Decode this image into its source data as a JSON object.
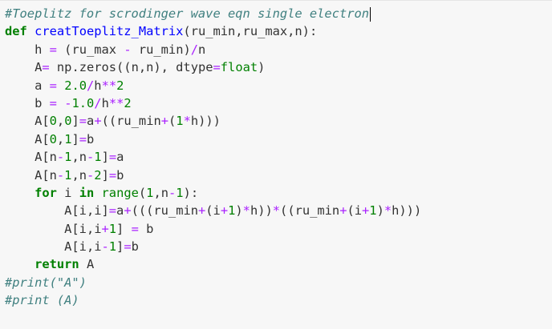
{
  "cell": {
    "lines": [
      {
        "i": "",
        "t": [
          {
            "c": "comment",
            "v": "#Toeplitz for scrodinger wave eqn single electron"
          }
        ]
      },
      {
        "i": "",
        "t": [
          {
            "c": "kw",
            "v": "def"
          },
          {
            "c": "p",
            "v": " "
          },
          {
            "c": "fn",
            "v": "creatToeplitz_Matrix"
          },
          {
            "c": "p",
            "v": "(ru_min,ru_max,n):"
          }
        ]
      },
      {
        "i": "    ",
        "t": [
          {
            "c": "p",
            "v": "h "
          },
          {
            "c": "op",
            "v": "="
          },
          {
            "c": "p",
            "v": " (ru_max "
          },
          {
            "c": "op",
            "v": "-"
          },
          {
            "c": "p",
            "v": " ru_min)"
          },
          {
            "c": "op",
            "v": "/"
          },
          {
            "c": "p",
            "v": "n"
          }
        ]
      },
      {
        "i": "    ",
        "t": [
          {
            "c": "p",
            "v": "A"
          },
          {
            "c": "op",
            "v": "="
          },
          {
            "c": "p",
            "v": " np.zeros((n,n), dtype"
          },
          {
            "c": "op",
            "v": "="
          },
          {
            "c": "builtin-type",
            "v": "float"
          },
          {
            "c": "p",
            "v": ")"
          }
        ]
      },
      {
        "i": "    ",
        "t": [
          {
            "c": "p",
            "v": "a "
          },
          {
            "c": "op",
            "v": "="
          },
          {
            "c": "p",
            "v": " "
          },
          {
            "c": "num",
            "v": "2.0"
          },
          {
            "c": "op",
            "v": "/"
          },
          {
            "c": "p",
            "v": "h"
          },
          {
            "c": "op",
            "v": "**"
          },
          {
            "c": "num",
            "v": "2"
          }
        ]
      },
      {
        "i": "    ",
        "t": [
          {
            "c": "p",
            "v": "b "
          },
          {
            "c": "op",
            "v": "="
          },
          {
            "c": "p",
            "v": " "
          },
          {
            "c": "op",
            "v": "-"
          },
          {
            "c": "num",
            "v": "1.0"
          },
          {
            "c": "op",
            "v": "/"
          },
          {
            "c": "p",
            "v": "h"
          },
          {
            "c": "op",
            "v": "**"
          },
          {
            "c": "num",
            "v": "2"
          }
        ]
      },
      {
        "i": "    ",
        "t": [
          {
            "c": "p",
            "v": "A["
          },
          {
            "c": "num",
            "v": "0"
          },
          {
            "c": "p",
            "v": ","
          },
          {
            "c": "num",
            "v": "0"
          },
          {
            "c": "p",
            "v": "]"
          },
          {
            "c": "op",
            "v": "="
          },
          {
            "c": "p",
            "v": "a"
          },
          {
            "c": "op",
            "v": "+"
          },
          {
            "c": "p",
            "v": "((ru_min"
          },
          {
            "c": "op",
            "v": "+"
          },
          {
            "c": "p",
            "v": "("
          },
          {
            "c": "num",
            "v": "1"
          },
          {
            "c": "op",
            "v": "*"
          },
          {
            "c": "p",
            "v": "h)))"
          }
        ]
      },
      {
        "i": "    ",
        "t": [
          {
            "c": "p",
            "v": "A["
          },
          {
            "c": "num",
            "v": "0"
          },
          {
            "c": "p",
            "v": ","
          },
          {
            "c": "num",
            "v": "1"
          },
          {
            "c": "p",
            "v": "]"
          },
          {
            "c": "op",
            "v": "="
          },
          {
            "c": "p",
            "v": "b"
          }
        ]
      },
      {
        "i": "    ",
        "t": [
          {
            "c": "p",
            "v": "A[n"
          },
          {
            "c": "op",
            "v": "-"
          },
          {
            "c": "num",
            "v": "1"
          },
          {
            "c": "p",
            "v": ",n"
          },
          {
            "c": "op",
            "v": "-"
          },
          {
            "c": "num",
            "v": "1"
          },
          {
            "c": "p",
            "v": "]"
          },
          {
            "c": "op",
            "v": "="
          },
          {
            "c": "p",
            "v": "a"
          }
        ]
      },
      {
        "i": "    ",
        "t": [
          {
            "c": "p",
            "v": "A[n"
          },
          {
            "c": "op",
            "v": "-"
          },
          {
            "c": "num",
            "v": "1"
          },
          {
            "c": "p",
            "v": ",n"
          },
          {
            "c": "op",
            "v": "-"
          },
          {
            "c": "num",
            "v": "2"
          },
          {
            "c": "p",
            "v": "]"
          },
          {
            "c": "op",
            "v": "="
          },
          {
            "c": "p",
            "v": "b"
          }
        ]
      },
      {
        "i": "    ",
        "t": [
          {
            "c": "kw",
            "v": "for"
          },
          {
            "c": "p",
            "v": " i "
          },
          {
            "c": "kw",
            "v": "in"
          },
          {
            "c": "p",
            "v": " "
          },
          {
            "c": "builtin-type",
            "v": "range"
          },
          {
            "c": "p",
            "v": "("
          },
          {
            "c": "num",
            "v": "1"
          },
          {
            "c": "p",
            "v": ",n"
          },
          {
            "c": "op",
            "v": "-"
          },
          {
            "c": "num",
            "v": "1"
          },
          {
            "c": "p",
            "v": "):"
          }
        ]
      },
      {
        "i": "        ",
        "t": [
          {
            "c": "p",
            "v": "A[i,i]"
          },
          {
            "c": "op",
            "v": "="
          },
          {
            "c": "p",
            "v": "a"
          },
          {
            "c": "op",
            "v": "+"
          },
          {
            "c": "p",
            "v": "(((ru_min"
          },
          {
            "c": "op",
            "v": "+"
          },
          {
            "c": "p",
            "v": "(i"
          },
          {
            "c": "op",
            "v": "+"
          },
          {
            "c": "num",
            "v": "1"
          },
          {
            "c": "p",
            "v": ")"
          },
          {
            "c": "op",
            "v": "*"
          },
          {
            "c": "p",
            "v": "h))"
          },
          {
            "c": "op",
            "v": "*"
          },
          {
            "c": "p",
            "v": "((ru_min"
          },
          {
            "c": "op",
            "v": "+"
          },
          {
            "c": "p",
            "v": "(i"
          },
          {
            "c": "op",
            "v": "+"
          },
          {
            "c": "num",
            "v": "1"
          },
          {
            "c": "p",
            "v": ")"
          },
          {
            "c": "op",
            "v": "*"
          },
          {
            "c": "p",
            "v": "h)))"
          }
        ]
      },
      {
        "i": "        ",
        "t": [
          {
            "c": "p",
            "v": "A[i,i"
          },
          {
            "c": "op",
            "v": "+"
          },
          {
            "c": "num",
            "v": "1"
          },
          {
            "c": "p",
            "v": "] "
          },
          {
            "c": "op",
            "v": "="
          },
          {
            "c": "p",
            "v": " b"
          }
        ]
      },
      {
        "i": "        ",
        "t": [
          {
            "c": "p",
            "v": "A[i,i"
          },
          {
            "c": "op",
            "v": "-"
          },
          {
            "c": "num",
            "v": "1"
          },
          {
            "c": "p",
            "v": "]"
          },
          {
            "c": "op",
            "v": "="
          },
          {
            "c": "p",
            "v": "b"
          }
        ]
      },
      {
        "i": "    ",
        "t": [
          {
            "c": "kw",
            "v": "return"
          },
          {
            "c": "p",
            "v": " A"
          }
        ]
      },
      {
        "i": "",
        "t": [
          {
            "c": "comment",
            "v": "#print(\"A\")"
          }
        ]
      },
      {
        "i": "",
        "t": [
          {
            "c": "comment",
            "v": "#print (A)"
          }
        ]
      }
    ],
    "cursor_line": 0
  }
}
